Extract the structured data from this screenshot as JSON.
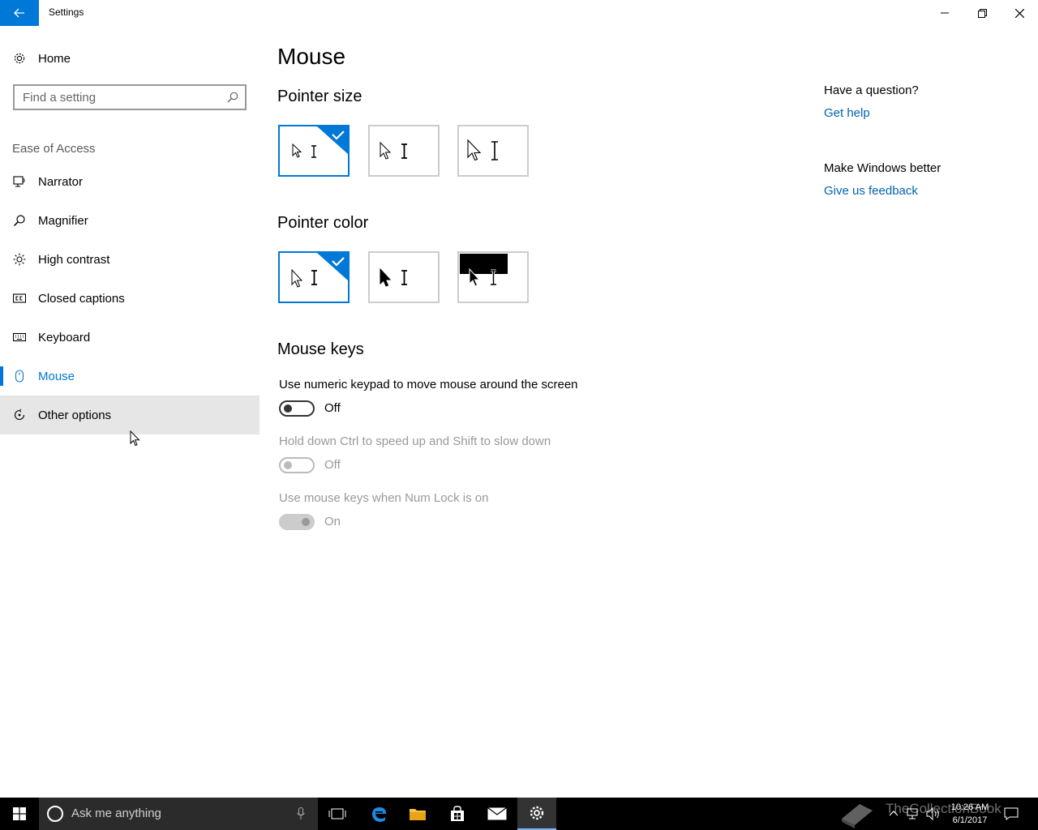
{
  "window": {
    "title": "Settings"
  },
  "sidebar": {
    "home_label": "Home",
    "search_placeholder": "Find a setting",
    "section_label": "Ease of Access",
    "items": [
      {
        "label": "Narrator",
        "icon": "narrator-icon"
      },
      {
        "label": "Magnifier",
        "icon": "magnifier-icon"
      },
      {
        "label": "High contrast",
        "icon": "high-contrast-icon"
      },
      {
        "label": "Closed captions",
        "icon": "closed-captions-icon"
      },
      {
        "label": "Keyboard",
        "icon": "keyboard-icon"
      },
      {
        "label": "Mouse",
        "icon": "mouse-icon",
        "selected": true
      },
      {
        "label": "Other options",
        "icon": "other-options-icon",
        "hovered": true
      }
    ]
  },
  "main": {
    "page_title": "Mouse",
    "pointer_size": {
      "heading": "Pointer size",
      "selected_index": 0
    },
    "pointer_color": {
      "heading": "Pointer color",
      "selected_index": 0
    },
    "mouse_keys": {
      "heading": "Mouse keys",
      "settings": [
        {
          "label": "Use numeric keypad to move mouse around the screen",
          "state": "Off",
          "enabled": true
        },
        {
          "label": "Hold down Ctrl to speed up and Shift to slow down",
          "state": "Off",
          "enabled": false
        },
        {
          "label": "Use mouse keys when Num Lock is on",
          "state": "On",
          "enabled": false
        }
      ]
    }
  },
  "aside": {
    "question_title": "Have a question?",
    "help_link": "Get help",
    "feedback_title": "Make Windows better",
    "feedback_link": "Give us feedback"
  },
  "taskbar": {
    "search_text": "Ask me anything",
    "time": "10:26 AM",
    "date": "6/1/2017",
    "watermark": "TheCollectionBook"
  },
  "colors": {
    "accent": "#0078d7",
    "link": "#0063b1",
    "hover": "#e6e6e6"
  }
}
